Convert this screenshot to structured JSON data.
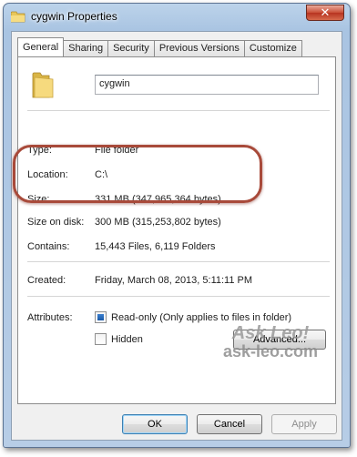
{
  "window": {
    "title": "cygwin Properties",
    "close_glyph": "✕"
  },
  "tabs": [
    {
      "label": "General",
      "active": true
    },
    {
      "label": "Sharing"
    },
    {
      "label": "Security"
    },
    {
      "label": "Previous Versions"
    },
    {
      "label": "Customize"
    }
  ],
  "general": {
    "folder_name": "cygwin",
    "type": {
      "label": "Type:",
      "value": "File folder"
    },
    "location": {
      "label": "Location:",
      "value": "C:\\"
    },
    "size": {
      "label": "Size:",
      "value": "331 MB (347,965,364 bytes)"
    },
    "size_on_disk": {
      "label": "Size on disk:",
      "value": "300 MB (315,253,802 bytes)"
    },
    "contains": {
      "label": "Contains:",
      "value": "15,443 Files, 6,119 Folders"
    },
    "created": {
      "label": "Created:",
      "value": "Friday, March 08, 2013, 5:11:11 PM"
    },
    "attributes": {
      "label": "Attributes:",
      "readonly": {
        "label": "Read-only (Only applies to files in folder)",
        "state": "indeterminate"
      },
      "hidden": {
        "label": "Hidden",
        "state": "unchecked"
      },
      "advanced_label": "Advanced..."
    }
  },
  "watermark": {
    "brand": "Ask Leo!",
    "url": "ask-leo.com"
  },
  "footer": {
    "ok_label": "OK",
    "cancel_label": "Cancel",
    "apply_label": "Apply"
  },
  "colors": {
    "highlight_ring": "#a84a3a",
    "checkbox_fill": "#1c5aa6",
    "title_gradient": "#bcd3ea"
  }
}
